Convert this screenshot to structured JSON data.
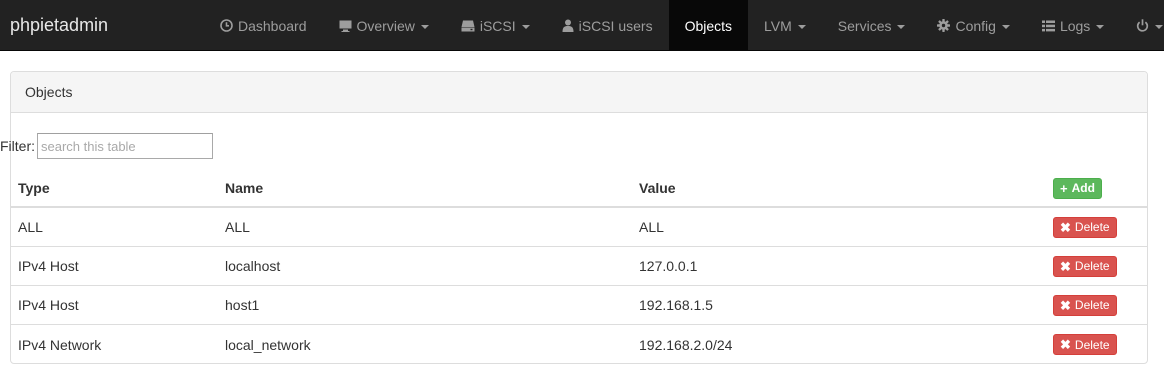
{
  "navbar": {
    "brand": "phpietadmin",
    "items": [
      {
        "label": "Dashboard",
        "icon": "dashboard-icon",
        "caret": false,
        "active": false
      },
      {
        "label": "Overview",
        "icon": "monitor-icon",
        "caret": true,
        "active": false
      },
      {
        "label": "iSCSI",
        "icon": "harddrive-icon",
        "caret": true,
        "active": false
      },
      {
        "label": "iSCSI users",
        "icon": "user-icon",
        "caret": false,
        "active": false
      },
      {
        "label": "Objects",
        "icon": "",
        "caret": false,
        "active": true
      },
      {
        "label": "LVM",
        "icon": "",
        "caret": true,
        "active": false
      },
      {
        "label": "Services",
        "icon": "",
        "caret": true,
        "active": false
      },
      {
        "label": "Config",
        "icon": "gear-icon",
        "caret": true,
        "active": false
      },
      {
        "label": "Logs",
        "icon": "list-icon",
        "caret": true,
        "active": false
      },
      {
        "label": "",
        "icon": "power-icon",
        "caret": true,
        "active": false
      }
    ]
  },
  "panel": {
    "title": "Objects",
    "filter": {
      "label": "Filter:",
      "placeholder": "search this table",
      "value": ""
    }
  },
  "table": {
    "columns": [
      "Type",
      "Name",
      "Value"
    ],
    "add_label": "Add",
    "delete_label": "Delete",
    "rows": [
      {
        "type": "ALL",
        "name": "ALL",
        "value": "ALL"
      },
      {
        "type": "IPv4 Host",
        "name": "localhost",
        "value": "127.0.0.1"
      },
      {
        "type": "IPv4 Host",
        "name": "host1",
        "value": "192.168.1.5"
      },
      {
        "type": "IPv4 Network",
        "name": "local_network",
        "value": "192.168.2.0/24"
      }
    ]
  },
  "colors": {
    "navbar_bg": "#222222",
    "active_nav_bg": "#080808",
    "add_button": "#5cb85c",
    "delete_button": "#d9534f"
  }
}
